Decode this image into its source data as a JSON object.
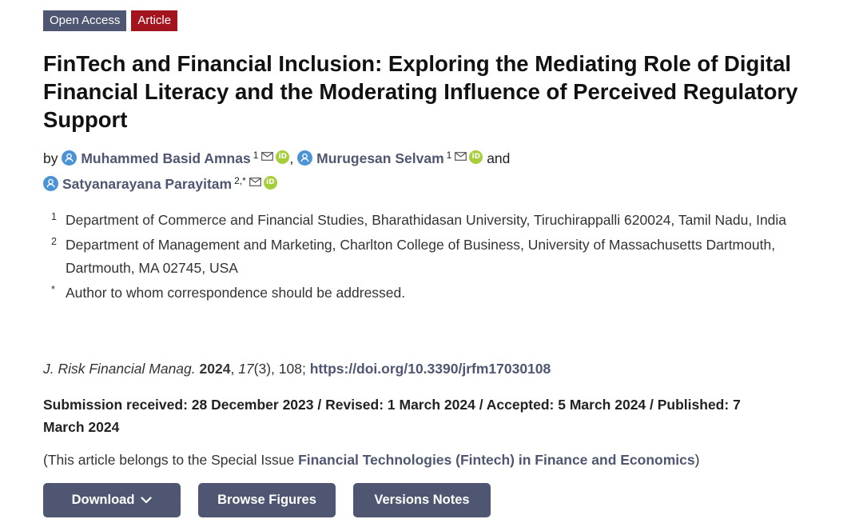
{
  "badges": {
    "open_access": "Open Access",
    "article": "Article"
  },
  "title": "FinTech and Financial Inclusion: Exploring the Mediating Role of Digital Financial Literacy and the Moderating Influence of Perceived Regulatory Support",
  "authors": {
    "by": "by",
    "list": [
      {
        "name": "Muhammed Basid Amnas",
        "affil": "1"
      },
      {
        "name": "Murugesan Selvam",
        "affil": "1"
      },
      {
        "name": "Satyanarayana Parayitam",
        "affil": "2,*"
      }
    ],
    "separator_comma": ",",
    "and": "and",
    "orcid_glyph": "iD"
  },
  "affiliations": [
    {
      "num": "1",
      "text": "Department of Commerce and Financial Studies, Bharathidasan University, Tiruchirappalli 620024, Tamil Nadu, India"
    },
    {
      "num": "2",
      "text": "Department of Management and Marketing, Charlton College of Business, University of Massachusetts Dartmouth, Dartmouth, MA 02745, USA"
    },
    {
      "num": "*",
      "text": "Author to whom correspondence should be addressed."
    }
  ],
  "citation": {
    "journal": "J. Risk Financial Manag.",
    "year": "2024",
    "comma1": ",",
    "volume": "17",
    "issue_pages": "(3), 108;",
    "doi": "https://doi.org/10.3390/jrfm17030108"
  },
  "dates": "Submission received: 28 December 2023 / Revised: 1 March 2024 / Accepted: 5 March 2024 / Published: 7 March 2024",
  "special_issue": {
    "prefix": "(This article belongs to the Special Issue ",
    "name": "Financial Technologies (Fintech) in Finance and Economics",
    "suffix": ")"
  },
  "buttons": {
    "download": "Download",
    "browse_figures": "Browse Figures",
    "versions_notes": "Versions Notes"
  },
  "colors": {
    "accent": "#4f5671",
    "article_badge": "#a3141f",
    "person_icon": "#4b93d6",
    "orcid": "#a6ce39"
  },
  "icons": [
    "person-icon",
    "mail-icon",
    "orcid-icon",
    "chevron-down-icon"
  ]
}
